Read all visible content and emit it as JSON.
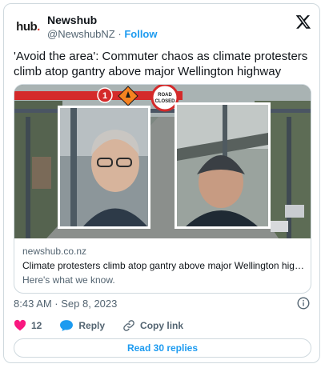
{
  "account": {
    "logo_text": "hub",
    "logo_dot": ".",
    "display_name": "Newshub",
    "handle": "@NewshubNZ",
    "separator": "·",
    "follow_label": "Follow"
  },
  "tweet": {
    "text": "'Avoid the area': Commuter chaos as climate protesters climb atop gantry above major Wellington highway"
  },
  "link_card": {
    "sign_number": "1",
    "sign_road_closed_line1": "ROAD",
    "sign_road_closed_line2": "CLOSED",
    "domain": "newshub.co.nz",
    "title": "Climate protesters climb atop gantry above major Wellington highway,...",
    "description": "Here's what we know."
  },
  "meta": {
    "timestamp": "8:43 AM · Sep 8, 2023"
  },
  "actions": {
    "like_count": "12",
    "reply_label": "Reply",
    "copy_label": "Copy link"
  },
  "replies_button": {
    "label": "Read 30 replies"
  },
  "colors": {
    "accent": "#1d9bf0",
    "like": "#f91880",
    "text_secondary": "#536471",
    "sign_red": "#d42a2a",
    "sign_orange": "#f58220"
  }
}
